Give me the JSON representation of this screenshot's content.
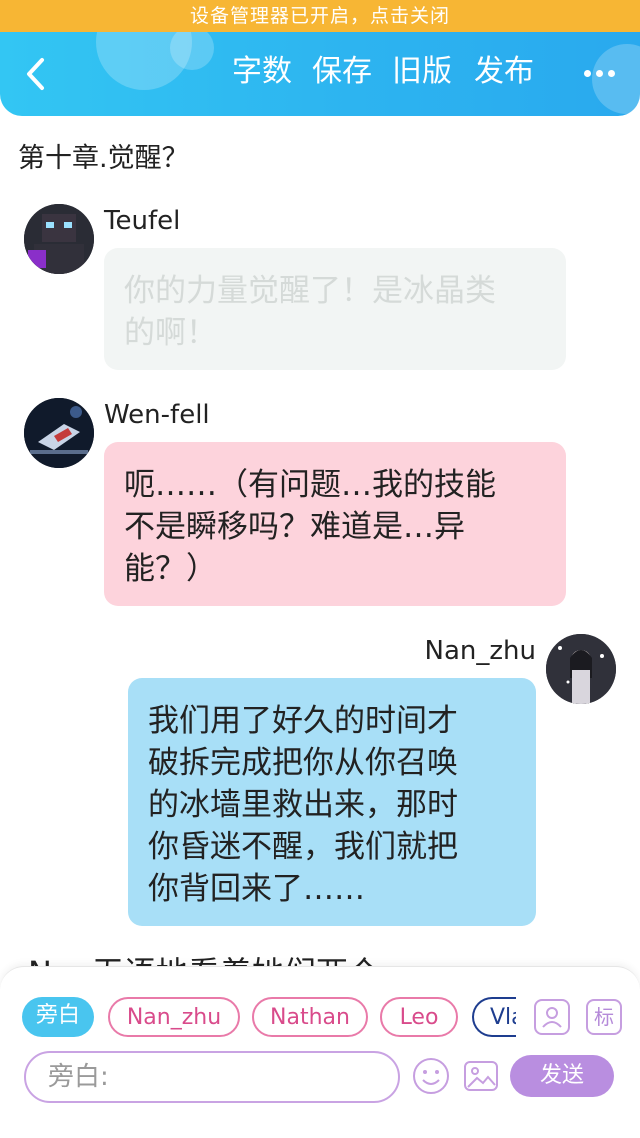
{
  "status_banner": "设备管理器已开启，点击关闭",
  "toolbar": {
    "back_icon": "chevron-left-icon",
    "actions": [
      "字数",
      "保存",
      "旧版",
      "发布"
    ],
    "more_icon": "more-dots-icon"
  },
  "chapter_title": "第十章.觉醒？",
  "messages": [
    {
      "speaker": "Teufel",
      "text_lines": [
        "你的力量觉醒了！是冰晶类",
        "的啊！"
      ],
      "style": "faded-gray",
      "avatar_icon": "teufel-avatar"
    },
    {
      "speaker": "Wen-fell",
      "text_lines": [
        "呃……（有问题…我的技能",
        "不是瞬移吗？难道是…异",
        "能？）"
      ],
      "style": "pink",
      "avatar_icon": "wenfell-avatar"
    },
    {
      "speaker": "Nan_zhu",
      "text_lines": [
        "我们用了好久的时间才",
        "破拆完成把你从你召唤",
        "的冰墙里救出来，那时",
        "你昏迷不醒，我们就把",
        "你背回来了……"
      ],
      "style": "blue",
      "avatar_icon": "nanzhu-avatar"
    }
  ],
  "partial_narration": "Nan无语地看着她们两个",
  "composer": {
    "roles": [
      "旁白",
      "Nan_zhu",
      "Nathan",
      "Leo",
      "Vla"
    ],
    "active_role": "旁白",
    "input_placeholder": "旁白:",
    "tag_button_label": "标",
    "send_label": "发送",
    "icons": [
      "character-card-icon",
      "tag-icon",
      "emoji-icon",
      "image-icon"
    ]
  },
  "colors": {
    "banner": "#f7b634",
    "toolbar": "#2db4f0",
    "bubble_pink": "#fdd3dc",
    "bubble_blue": "#a8dff7",
    "send_button": "#b98ee0"
  }
}
